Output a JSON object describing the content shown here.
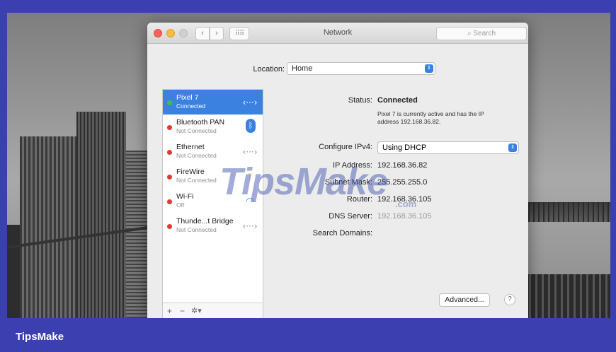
{
  "window": {
    "title": "Network",
    "search_placeholder": "Search",
    "back_glyph": "‹",
    "forward_glyph": "›",
    "grid_glyph": "⠿⠿"
  },
  "location": {
    "label": "Location:",
    "value": "Home"
  },
  "services": [
    {
      "name": "Pixel 7",
      "status": "Connected",
      "selected": true,
      "icon": "ethernet-arrows-icon",
      "state_color": "#3fbf44"
    },
    {
      "name": "Bluetooth PAN",
      "status": "Not Connected",
      "selected": false,
      "icon": "bluetooth-icon",
      "state_color": "#e3382f"
    },
    {
      "name": "Ethernet",
      "status": "Not Connected",
      "selected": false,
      "icon": "ethernet-arrows-icon",
      "state_color": "#e3382f"
    },
    {
      "name": "FireWire",
      "status": "Not Connected",
      "selected": false,
      "icon": "firewire-icon",
      "state_color": "#e3382f"
    },
    {
      "name": "Wi-Fi",
      "status": "Off",
      "selected": false,
      "icon": "wifi-icon",
      "state_color": "#e3382f"
    },
    {
      "name": "Thunde...t Bridge",
      "status": "Not Connected",
      "selected": false,
      "icon": "ethernet-arrows-icon",
      "state_color": "#e3382f"
    }
  ],
  "list_toolbar": {
    "add": "+",
    "remove": "−",
    "gear": "✲▾"
  },
  "detail": {
    "status_label": "Status:",
    "status_value": "Connected",
    "status_note": "Pixel 7 is currently active and has the IP address 192.168.36.82.",
    "configure_label": "Configure IPv4:",
    "configure_value": "Using DHCP",
    "ip_label": "IP Address:",
    "ip_value": "192.168.36.82",
    "subnet_label": "Subnet Mask:",
    "subnet_value": "255.255.255.0",
    "router_label": "Router:",
    "router_value": "192.168.36.105",
    "dns_label": "DNS Server:",
    "dns_value": "192.168.36.105",
    "search_domains_label": "Search Domains:",
    "advanced_label": "Advanced...",
    "help_label": "?"
  },
  "watermark": {
    "text": "TipsMake",
    "suffix": ".com"
  },
  "footer": {
    "brand": "TipsMake"
  },
  "colors": {
    "accent": "#3b82e0",
    "frame": "#3b3fb0"
  }
}
